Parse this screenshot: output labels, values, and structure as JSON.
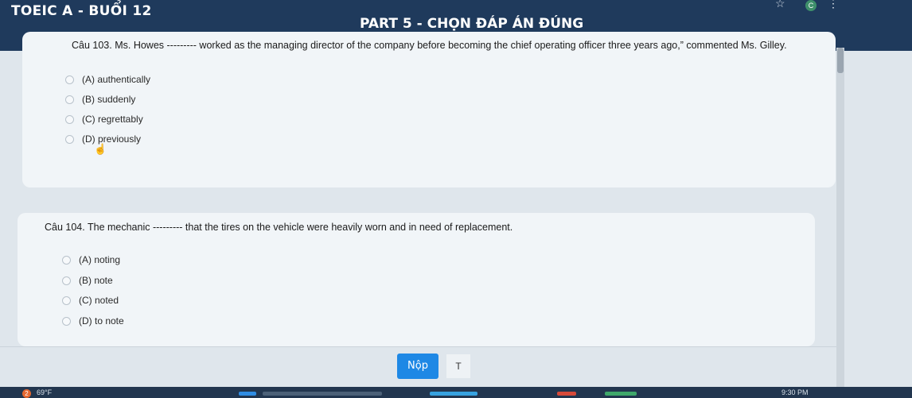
{
  "header": {
    "title": "TOEIC A - BUỔI 12",
    "part_title": "PART 5 - CHỌN ĐÁP ÁN ĐÚNG",
    "avatar_letter": "C"
  },
  "questions": [
    {
      "text": "Câu 103. Ms. Howes --------- worked as the managing director of the company before becoming the chief operating officer three years ago,” commented Ms. Gilley.",
      "options": [
        "(A) authentically",
        "(B) suddenly",
        "(C) regrettably",
        "(D) previously"
      ]
    },
    {
      "text": "Câu 104. The mechanic --------- that the tires on the vehicle were heavily worn and in need of replacement.",
      "options": [
        "(A) noting",
        "(B) note",
        "(C) noted",
        "(D) to note"
      ]
    }
  ],
  "submit_label": "Nộp",
  "text_tool_label": "T",
  "taskbar": {
    "badge": "2",
    "temperature": "69°F",
    "time": "9:30 PM"
  },
  "colors": {
    "header_bg": "#1f3a5c",
    "submit_bg": "#1e88e5",
    "card_bg": "#f1f5f8"
  }
}
